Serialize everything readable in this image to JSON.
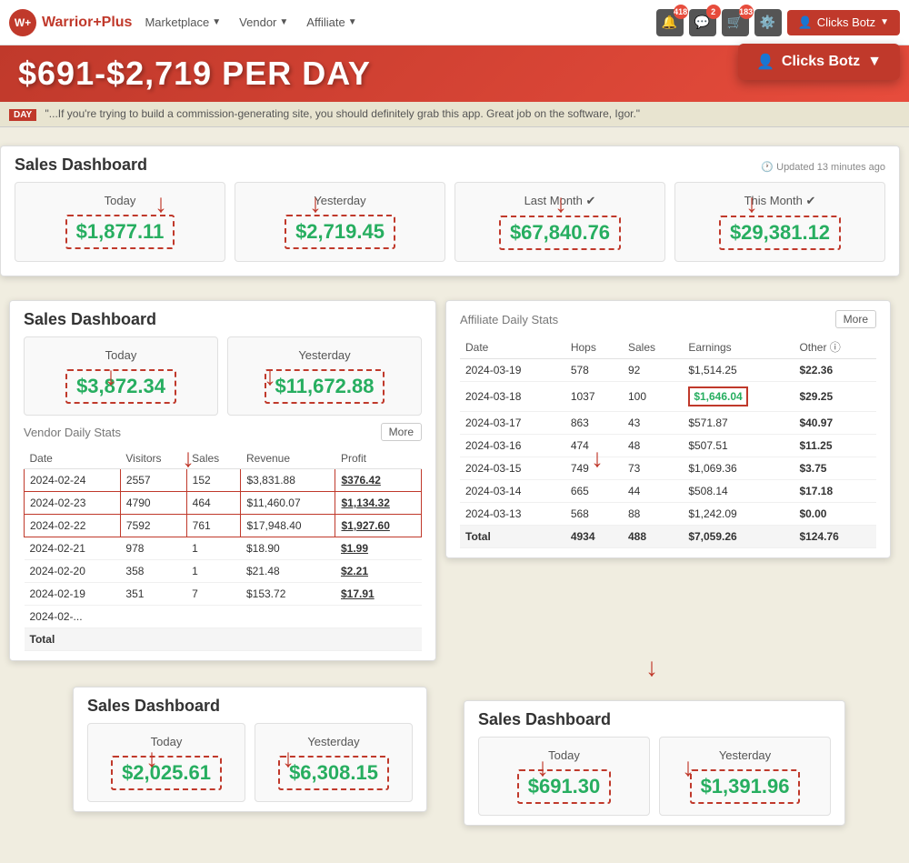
{
  "brand": {
    "icon": "W+",
    "name": "Warrior",
    "plus": "+Plus"
  },
  "navbar": {
    "marketplace": "Marketplace",
    "vendor": "Vendor",
    "affiliate": "Affiliate",
    "badges": [
      {
        "icon": "🔔",
        "count": "418"
      },
      {
        "icon": "💬",
        "count": "2"
      },
      {
        "icon": "🛒",
        "count": "183"
      },
      {
        "icon": "⚙️",
        "count": ""
      }
    ],
    "user_btn": "Clicks Botz"
  },
  "user_dropdown": {
    "name": "Clicks Botz"
  },
  "hero": {
    "text": "$691-$2,719 PER DAY"
  },
  "testimonial": {
    "tag": "DAY",
    "text": "\"...If you're trying to build a commission-generating site, you should definitely grab this app. Great job on the software, Igor.\""
  },
  "sales_panel_1": {
    "title": "Sales Dashboard",
    "updated": "Updated 13 minutes ago",
    "stats": [
      {
        "label": "Today",
        "value": "$1,877.11"
      },
      {
        "label": "Yesterday",
        "value": "$2,719.45"
      },
      {
        "label": "Last Month",
        "value": "$67,840.76"
      },
      {
        "label": "This Month",
        "value": "$29,381.12"
      }
    ]
  },
  "sales_panel_2": {
    "title": "Sales Dashboard",
    "stats": [
      {
        "label": "Today",
        "value": "$3,872.34"
      },
      {
        "label": "Yesterday",
        "value": "$11,672.88"
      }
    ],
    "vendor_section": "Vendor Daily Stats",
    "more_btn": "More",
    "table": {
      "headers": [
        "Date",
        "Visitors",
        "Sales",
        "Revenue",
        "Profit"
      ],
      "rows": [
        {
          "date": "2024-02-24",
          "visitors": "2557",
          "sales": "152",
          "revenue": "$3,831.88",
          "profit": "$376.42",
          "highlight": true
        },
        {
          "date": "2024-02-23",
          "visitors": "4790",
          "sales": "464",
          "revenue": "$11,460.07",
          "profit": "$1,134.32",
          "highlight": true
        },
        {
          "date": "2024-02-22",
          "visitors": "7592",
          "sales": "761",
          "revenue": "$17,948.40",
          "profit": "$1,927.60",
          "highlight": true
        },
        {
          "date": "2024-02-21",
          "visitors": "978",
          "sales": "1",
          "revenue": "$18.90",
          "profit": "$1.99",
          "highlight": false
        },
        {
          "date": "2024-02-20",
          "visitors": "358",
          "sales": "1",
          "revenue": "$21.48",
          "profit": "$2.21",
          "highlight": false
        },
        {
          "date": "2024-02-19",
          "visitors": "351",
          "sales": "7",
          "revenue": "$153.72",
          "profit": "$17.91",
          "highlight": false
        },
        {
          "date": "2024-02-...",
          "visitors": "",
          "sales": "",
          "revenue": "",
          "profit": "",
          "highlight": false
        }
      ],
      "total_row": {
        "label": "Total",
        "visitors": "",
        "sales": "",
        "revenue": "",
        "profit": ""
      }
    }
  },
  "affiliate_panel": {
    "title": "Affiliate Daily Stats",
    "more_btn": "More",
    "table": {
      "headers": [
        "Date",
        "Hops",
        "Sales",
        "Earnings",
        "Other"
      ],
      "rows": [
        {
          "date": "2024-03-19",
          "hops": "578",
          "sales": "92",
          "earnings": "$1,514.25",
          "other": "$22.36",
          "highlight_earnings": false
        },
        {
          "date": "2024-03-18",
          "hops": "1037",
          "sales": "100",
          "earnings": "$1,646.04",
          "other": "$29.25",
          "highlight_earnings": true
        },
        {
          "date": "2024-03-17",
          "hops": "863",
          "sales": "43",
          "earnings": "$571.87",
          "other": "$40.97",
          "highlight_earnings": false
        },
        {
          "date": "2024-03-16",
          "hops": "474",
          "sales": "48",
          "earnings": "$507.51",
          "other": "$11.25",
          "highlight_earnings": false
        },
        {
          "date": "2024-03-15",
          "hops": "749",
          "sales": "73",
          "earnings": "$1,069.36",
          "other": "$3.75",
          "highlight_earnings": false
        },
        {
          "date": "2024-03-14",
          "hops": "665",
          "sales": "44",
          "earnings": "$508.14",
          "other": "$17.18",
          "highlight_earnings": false
        },
        {
          "date": "2024-03-13",
          "hops": "568",
          "sales": "88",
          "earnings": "$1,242.09",
          "other": "$0.00",
          "highlight_earnings": false
        }
      ],
      "total_row": {
        "label": "Total",
        "hops": "4934",
        "sales": "488",
        "earnings": "$7,059.26",
        "other": "$124.76"
      }
    }
  },
  "sales_panel_3": {
    "title": "Sales Dashboard",
    "stats": [
      {
        "label": "Today",
        "value": "$2,025.61"
      },
      {
        "label": "Yesterday",
        "value": "$6,308.15"
      }
    ]
  },
  "sales_panel_4": {
    "title": "Sales Dashboard",
    "stats": [
      {
        "label": "Today",
        "value": "$691.30"
      },
      {
        "label": "Yesterday",
        "value": "$1,391.96"
      }
    ]
  }
}
